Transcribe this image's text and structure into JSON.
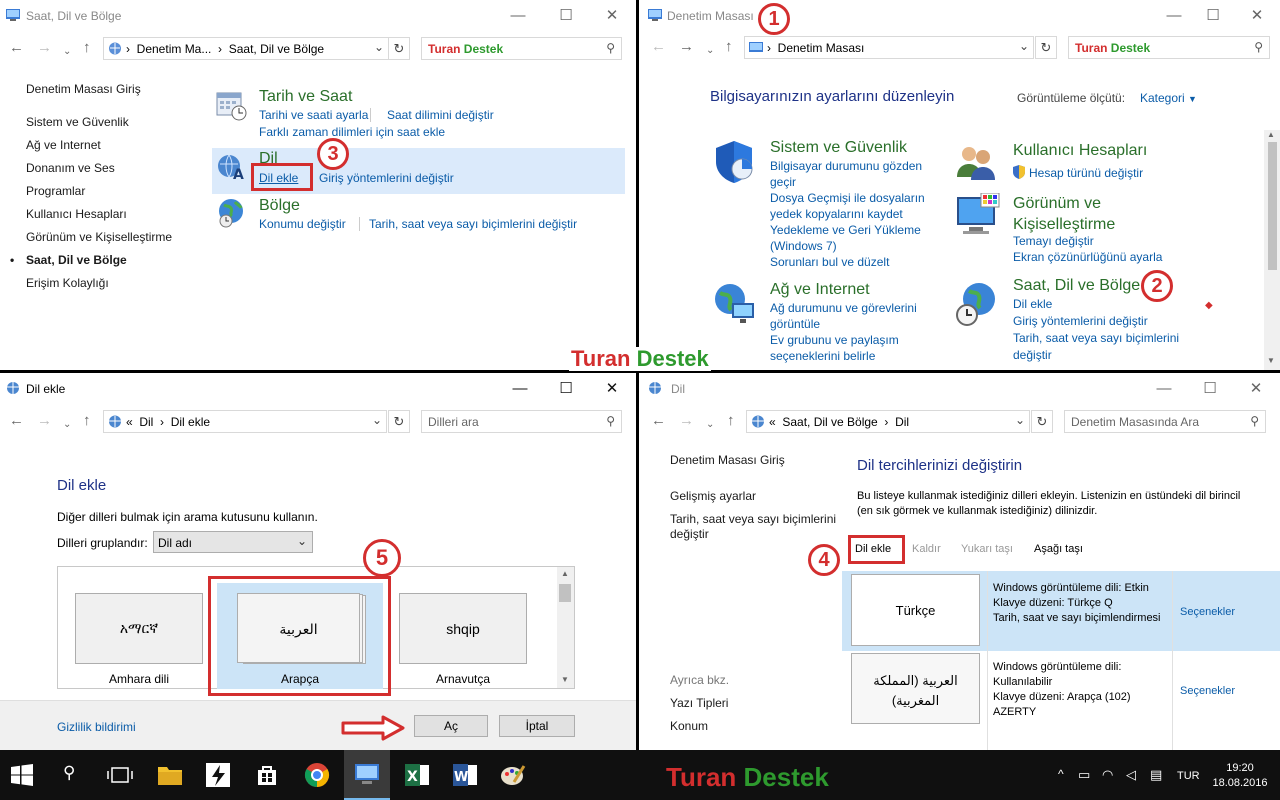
{
  "brand": {
    "tur": "Turan",
    "des": "Destek",
    "tur_color": "#d32e2e",
    "des_color": "#2e9a2e"
  },
  "tl": {
    "title": "Saat, Dil ve Bölge",
    "addr": [
      "Denetim Ma...",
      "Saat, Dil ve Bölge"
    ],
    "side": [
      "Denetim Masası Giriş",
      "Sistem ve Güvenlik",
      "Ağ ve Internet",
      "Donanım ve Ses",
      "Programlar",
      "Kullanıcı Hesapları",
      "Görünüm ve Kişiselleştirme",
      "Saat, Dil ve Bölge",
      "Erişim Kolaylığı"
    ],
    "cat1": {
      "title": "Tarih ve Saat",
      "l1": "Tarihi ve saati ayarla",
      "l2": "Saat dilimini değiştir",
      "l3": "Farklı zaman dilimleri için saat ekle"
    },
    "cat2": {
      "title": "Dil",
      "l1": "Dil ekle",
      "l2": "Giriş yöntemlerini değiştir"
    },
    "cat3": {
      "title": "Bölge",
      "l1": "Konumu değiştir",
      "l2": "Tarih, saat veya sayı biçimlerini değiştir"
    }
  },
  "tr": {
    "title": "Denetim Masası",
    "addr": "Denetim Masası",
    "heading": "Bilgisayarınızın ayarlarını düzenleyin",
    "view_label": "Görüntüleme ölçütü:",
    "view_value": "Kategori",
    "c1": {
      "title": "Sistem ve Güvenlik",
      "links": [
        "Bilgisayar durumunu gözden geçir",
        "Dosya Geçmişi ile dosyaların yedek kopyalarını kaydet",
        "Yedekleme ve Geri Yükleme (Windows 7)",
        "Sorunları bul ve düzelt"
      ]
    },
    "c2": {
      "title": "Ağ ve Internet",
      "links": [
        "Ağ durumunu ve görevlerini görüntüle",
        "Ev grubunu ve paylaşım seçeneklerini belirle"
      ]
    },
    "c3": {
      "title": "Kullanıcı Hesapları",
      "links": [
        "Hesap türünü değiştir"
      ]
    },
    "c4": {
      "title": "Görünüm ve Kişiselleştirme",
      "links": [
        "Temayı değiştir",
        "Ekran çözünürlüğünü ayarla"
      ]
    },
    "c5": {
      "title": "Saat, Dil ve Bölge",
      "links": [
        "Dil ekle",
        "Giriş yöntemlerini değiştir",
        "Tarih, saat veya sayı biçimlerini değiştir"
      ]
    }
  },
  "bl": {
    "title": "Dil ekle",
    "addr": [
      "Dil",
      "Dil ekle"
    ],
    "search_placeholder": "Dilleri ara",
    "heading": "Dil ekle",
    "desc": "Diğer dilleri bulmak için arama kutusunu kullanın.",
    "group_label": "Dilleri gruplandır:",
    "group_value": "Dil adı",
    "tiles": [
      {
        "script": "አማርኛ",
        "name": "Amhara dili"
      },
      {
        "script": "العربية",
        "name": "Arapça"
      },
      {
        "script": "shqip",
        "name": "Arnavutça"
      }
    ],
    "privacy": "Gizlilik bildirimi",
    "open": "Aç",
    "cancel": "İptal"
  },
  "br": {
    "title": "Dil",
    "addr": [
      "Saat, Dil ve Bölge",
      "Dil"
    ],
    "search_placeholder": "Denetim Masasında Ara",
    "side": [
      "Denetim Masası Giriş",
      "Gelişmiş ayarlar",
      "Tarih, saat veya sayı biçimlerini değiştir"
    ],
    "also": "Ayrıca bkz.",
    "also_links": [
      "Yazı Tipleri",
      "Konum"
    ],
    "heading": "Dil tercihlerinizi değiştirin",
    "desc": "Bu listeye kullanmak istediğiniz dilleri ekleyin. Listenizin en üstündeki dil birincil (en sık görmek ve kullanmak istediğiniz) dilinizdir.",
    "toolbar": [
      "Dil ekle",
      "Kaldır",
      "Yukarı taşı",
      "Aşağı taşı"
    ],
    "langs": [
      {
        "name": "Türkçe",
        "info": [
          "Windows görüntüleme dili: Etkin",
          "Klavye düzeni: Türkçe Q",
          "Tarih, saat ve sayı biçimlendirmesi"
        ],
        "opt": "Seçenekler"
      },
      {
        "name": "العربية (المملكة المغربية)",
        "info": [
          "Windows görüntüleme dili: Kullanılabilir",
          "Klavye düzeni: Arapça (102) AZERTY"
        ],
        "opt": "Seçenekler"
      }
    ]
  },
  "steps": [
    "1",
    "2",
    "3",
    "4",
    "5"
  ],
  "taskbar": {
    "lang": "TUR",
    "time": "19:20",
    "date": "18.08.2016"
  }
}
